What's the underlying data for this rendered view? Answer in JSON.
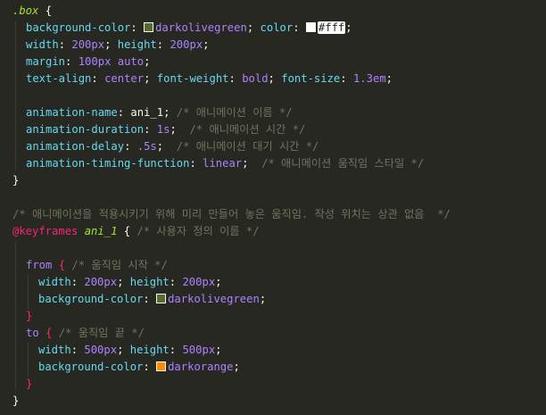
{
  "colors": {
    "background": "#272822",
    "darkolivegreen": "#556b2f",
    "white": "#ffffff",
    "darkorange": "#ff8c00"
  },
  "code": {
    "l1": {
      "selector": ".box",
      "brace": " {"
    },
    "l2": {
      "p1": "background-color",
      "v1": "darkolivegreen",
      "p2": "color",
      "v2": "#fff"
    },
    "l3": {
      "p1": "width",
      "v1": "200px",
      "p2": "height",
      "v2": "200px"
    },
    "l4": {
      "p1": "margin",
      "v1": "100px auto"
    },
    "l5": {
      "p1": "text-align",
      "v1": "center",
      "p2": "font-weight",
      "v2": "bold",
      "p3": "font-size",
      "v3": "1.3em"
    },
    "l7": {
      "p": "animation-name",
      "v": "ani_1",
      "c": "/* 애니메이션 이름 */"
    },
    "l8": {
      "p": "animation-duration",
      "v": "1s",
      "c": "/* 애니메이션 시간 */"
    },
    "l9": {
      "p": "animation-delay",
      "v": ".5s",
      "c": "/* 애니메이션 대기 시간 */"
    },
    "l10": {
      "p": "animation-timing-function",
      "v": "linear",
      "c": "/* 애니메이션 움직임 스타일 */"
    },
    "l11": {
      "brace": "}"
    },
    "l13": {
      "c": "/* 애니메이션을 적용시키기 위해 미리 만들어 놓은 움직임. 작성 위치는 상관 없음  */"
    },
    "l14": {
      "at": "@keyframes",
      "name": "ani_1",
      "c": "/* 사용자 정의 이름 */"
    },
    "l16": {
      "kw": "from",
      "c": "/* 움직임 시작 */"
    },
    "l17": {
      "p1": "width",
      "v1": "200px",
      "p2": "height",
      "v2": "200px"
    },
    "l18": {
      "p": "background-color",
      "v": "darkolivegreen"
    },
    "l19": {
      "brace": "}"
    },
    "l20": {
      "kw": "to",
      "c": "/* 움직임 끝 */"
    },
    "l21": {
      "p1": "width",
      "v1": "500px",
      "p2": "height",
      "v2": "500px"
    },
    "l22": {
      "p": "background-color",
      "v": "darkorange"
    },
    "l23": {
      "brace": "}"
    },
    "l24": {
      "brace": "}"
    }
  }
}
